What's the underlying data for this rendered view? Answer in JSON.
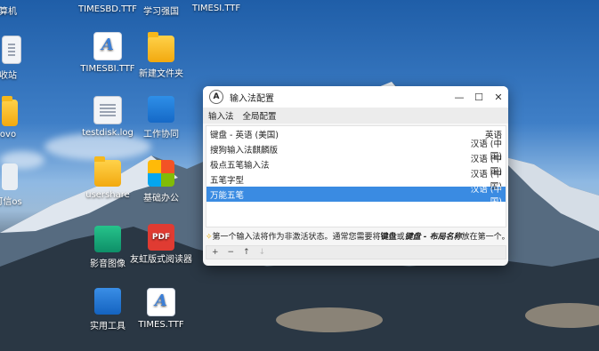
{
  "desktop": {
    "icons": [
      {
        "label": "算机",
        "icon": "computer-icon"
      },
      {
        "label": "TIMESBD.TTF",
        "icon": "font-file-icon"
      },
      {
        "label": "学习强国",
        "icon": "app-icon"
      },
      {
        "label": "TIMESI.TTF",
        "icon": "font-file-icon"
      },
      {
        "label": "收站",
        "icon": "trash-icon"
      },
      {
        "label": "TIMESBI.TTF",
        "icon": "font-file-icon"
      },
      {
        "label": "新建文件夹",
        "icon": "folder-icon"
      },
      {
        "label": "ovo",
        "icon": "app-icon"
      },
      {
        "label": "testdisk.log",
        "icon": "document-icon"
      },
      {
        "label": "工作协同",
        "icon": "team-icon"
      },
      {
        "label": "可信os",
        "icon": "app-icon"
      },
      {
        "label": "usershare",
        "icon": "folder-icon"
      },
      {
        "label": "基础办公",
        "icon": "office-icon"
      },
      {
        "label": "影音图像",
        "icon": "media-icon"
      },
      {
        "label": "友虹版式阅读器",
        "icon": "pdf-reader-icon"
      },
      {
        "label": "实用工具",
        "icon": "tools-icon"
      },
      {
        "label": "TIMES.TTF",
        "icon": "font-file-icon"
      }
    ]
  },
  "window": {
    "title": "输入法配置",
    "app_icon_text": "A",
    "controls": {
      "minimize": "—",
      "maximize": "☐",
      "close": "✕"
    },
    "tabs": [
      "输入法",
      "全局配置"
    ],
    "methods": [
      {
        "name": "键盘 - 英语 (美国)",
        "lang": "英语",
        "selected": false
      },
      {
        "name": "搜狗输入法麒麟版",
        "lang": "汉语 (中国)",
        "selected": false
      },
      {
        "name": "极点五笔输入法",
        "lang": "汉语 (中国)",
        "selected": false
      },
      {
        "name": "五笔字型",
        "lang": "汉语 (中国)",
        "selected": false
      },
      {
        "name": "万能五笔",
        "lang": "汉语 (中国)",
        "selected": true
      }
    ],
    "hint": {
      "p1": "第一个输入法将作为非激活状态。通常您需要将",
      "b1": "键盘",
      "p2": "或",
      "b2": "键盘 - 布局名称",
      "p3": "放在第一个。"
    },
    "toolbar": {
      "add": "+",
      "remove": "−",
      "up": "↑",
      "down": "↓"
    }
  }
}
